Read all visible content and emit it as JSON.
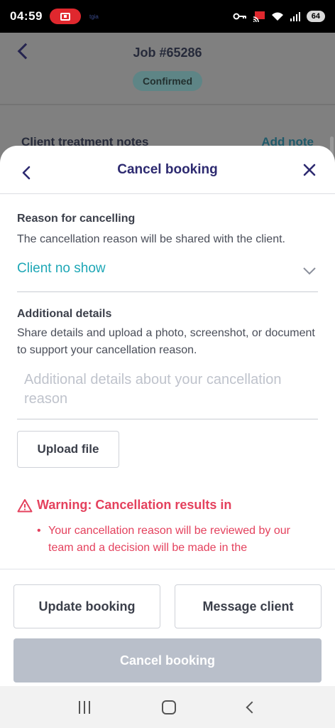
{
  "status_bar": {
    "time": "04:59",
    "tiny_text": "tgia",
    "battery": "64"
  },
  "background_page": {
    "title": "Job #65286",
    "status_badge": "Confirmed",
    "section_title": "Client treatment notes",
    "add_note_label": "Add note"
  },
  "sheet": {
    "title": "Cancel booking",
    "reason": {
      "label": "Reason for cancelling",
      "help": "The cancellation reason will be shared with the client.",
      "selected_value": "Client no show"
    },
    "details": {
      "label": "Additional details",
      "help": "Share details and upload a photo, screenshot, or document to support your cancellation reason.",
      "placeholder": "Additional details about your cancellation reason"
    },
    "upload_label": "Upload file",
    "warning": {
      "title": "Warning: Cancellation results in",
      "items": [
        "Your cancellation reason will be reviewed by our team and a decision will be made in the"
      ]
    }
  },
  "footer": {
    "update_label": "Update booking",
    "message_label": "Message client",
    "cancel_label": "Cancel booking"
  },
  "colors": {
    "accent": "#1ea7b6",
    "title": "#2d2a70",
    "warning": "#e4415d",
    "disabled": "#b9bfca"
  }
}
